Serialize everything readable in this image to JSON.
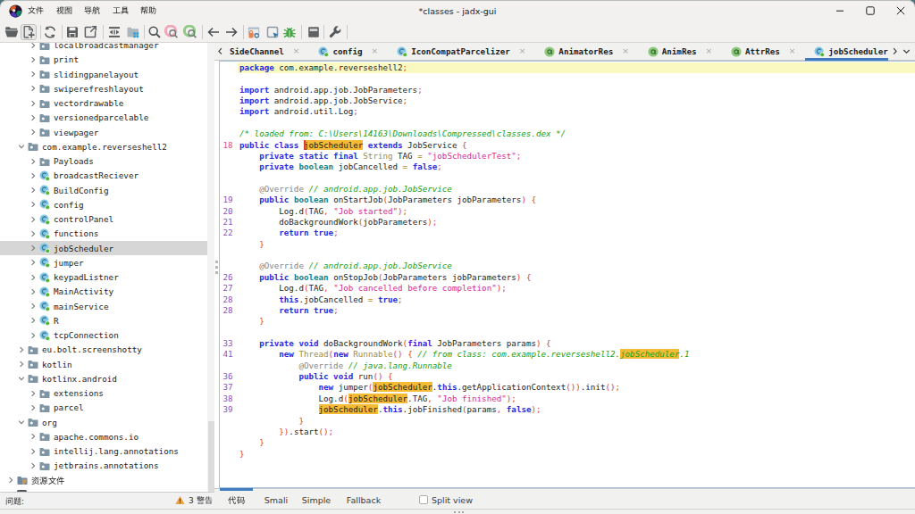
{
  "window": {
    "title": "*classes - jadx-gui",
    "menus": [
      "文件",
      "视图",
      "导航",
      "工具",
      "帮助"
    ],
    "controls": {
      "minimize": "minimize",
      "maximize": "maximize",
      "close": "close"
    }
  },
  "toolbar": {
    "items": [
      "open-file",
      "add-files",
      "reload",
      "save-all",
      "export",
      "deobfuscation",
      "flat-packages",
      "text-search",
      "class-search",
      "comment-search",
      "back",
      "forward",
      "open-main-activity",
      "select-in-tree",
      "debugger",
      "log-viewer",
      "preferences"
    ]
  },
  "tree": {
    "items": [
      {
        "label": "localbroadcastmanager",
        "icon": "package",
        "level": 2,
        "exp": false,
        "sel": false
      },
      {
        "label": "print",
        "icon": "package",
        "level": 2,
        "exp": false,
        "sel": false
      },
      {
        "label": "slidingpanelayout",
        "icon": "package",
        "level": 2,
        "exp": false,
        "sel": false
      },
      {
        "label": "swiperefreshlayout",
        "icon": "package",
        "level": 2,
        "exp": false,
        "sel": false
      },
      {
        "label": "vectordrawable",
        "icon": "package",
        "level": 2,
        "exp": false,
        "sel": false
      },
      {
        "label": "versionedparcelable",
        "icon": "package",
        "level": 2,
        "exp": false,
        "sel": false
      },
      {
        "label": "viewpager",
        "icon": "package",
        "level": 2,
        "exp": false,
        "sel": false
      },
      {
        "label": "com.example.reverseshell2",
        "icon": "package",
        "level": 1,
        "exp": true,
        "sel": false
      },
      {
        "label": "Payloads",
        "icon": "package",
        "level": 2,
        "exp": false,
        "sel": false
      },
      {
        "label": "broadcastReciever",
        "icon": "class",
        "level": 2,
        "exp": false,
        "sel": false
      },
      {
        "label": "BuildConfig",
        "icon": "class",
        "level": 2,
        "exp": false,
        "sel": false
      },
      {
        "label": "config",
        "icon": "class",
        "level": 2,
        "exp": false,
        "sel": false
      },
      {
        "label": "controlPanel",
        "icon": "class",
        "level": 2,
        "exp": false,
        "sel": false
      },
      {
        "label": "functions",
        "icon": "class",
        "level": 2,
        "exp": false,
        "sel": false
      },
      {
        "label": "jobScheduler",
        "icon": "class",
        "level": 2,
        "exp": false,
        "sel": true
      },
      {
        "label": "jumper",
        "icon": "class",
        "level": 2,
        "exp": false,
        "sel": false
      },
      {
        "label": "keypadListner",
        "icon": "class",
        "level": 2,
        "exp": false,
        "sel": false
      },
      {
        "label": "MainActivity",
        "icon": "class",
        "level": 2,
        "exp": false,
        "sel": false
      },
      {
        "label": "mainService",
        "icon": "class",
        "level": 2,
        "exp": false,
        "sel": false
      },
      {
        "label": "R",
        "icon": "class",
        "level": 2,
        "exp": false,
        "sel": false
      },
      {
        "label": "tcpConnection",
        "icon": "class",
        "level": 2,
        "exp": false,
        "sel": false
      },
      {
        "label": "eu.bolt.screenshotty",
        "icon": "package",
        "level": 1,
        "exp": false,
        "sel": false
      },
      {
        "label": "kotlin",
        "icon": "package",
        "level": 1,
        "exp": false,
        "sel": false
      },
      {
        "label": "kotlinx.android",
        "icon": "package",
        "level": 1,
        "exp": true,
        "sel": false
      },
      {
        "label": "extensions",
        "icon": "package",
        "level": 2,
        "exp": false,
        "sel": false
      },
      {
        "label": "parcel",
        "icon": "package",
        "level": 2,
        "exp": false,
        "sel": false
      },
      {
        "label": "org",
        "icon": "package",
        "level": 1,
        "exp": true,
        "sel": false
      },
      {
        "label": "apache.commons.io",
        "icon": "package",
        "level": 2,
        "exp": false,
        "sel": false
      },
      {
        "label": "intellij.lang.annotations",
        "icon": "package",
        "level": 2,
        "exp": false,
        "sel": false
      },
      {
        "label": "jetbrains.annotations",
        "icon": "package",
        "level": 2,
        "exp": false,
        "sel": false
      },
      {
        "label": "资源文件",
        "icon": "resdir",
        "level": 0,
        "exp": false,
        "sel": false,
        "cjk": true
      },
      {
        "label": "",
        "icon": "cut",
        "level": 0,
        "exp": false,
        "sel": false
      }
    ]
  },
  "problems": {
    "label": "问题:",
    "warn_count": "3",
    "warn_label": "警告"
  },
  "editor_tabs": [
    {
      "label": "SideChannel",
      "icon": "none",
      "active": false,
      "close": true
    },
    {
      "label": "config",
      "icon": "class",
      "active": false,
      "close": true
    },
    {
      "label": "IconCompatParcelizer",
      "icon": "class",
      "active": false,
      "close": true
    },
    {
      "label": "AnimatorRes",
      "icon": "annotation",
      "active": false,
      "close": true
    },
    {
      "label": "AnimRes",
      "icon": "annotation",
      "active": false,
      "close": true
    },
    {
      "label": "AttrRes",
      "icon": "annotation",
      "active": false,
      "close": true
    },
    {
      "label": "jobScheduler",
      "icon": "class",
      "active": true,
      "close": false
    }
  ],
  "code": {
    "lines": [
      {
        "n": "",
        "cur": true,
        "segs": [
          [
            "k",
            "package"
          ],
          [
            "i",
            " com.example.reverseshell2"
          ],
          [
            "p",
            ";"
          ]
        ]
      },
      {
        "n": "",
        "segs": []
      },
      {
        "n": "",
        "segs": [
          [
            "k",
            "import"
          ],
          [
            "i",
            " android.app.job.JobParameters"
          ],
          [
            "p",
            ";"
          ]
        ]
      },
      {
        "n": "",
        "segs": [
          [
            "k",
            "import"
          ],
          [
            "i",
            " android.app.job.JobService"
          ],
          [
            "p",
            ";"
          ]
        ]
      },
      {
        "n": "",
        "segs": [
          [
            "k",
            "import"
          ],
          [
            "i",
            " android.util.Log"
          ],
          [
            "p",
            ";"
          ]
        ]
      },
      {
        "n": "",
        "segs": []
      },
      {
        "n": "",
        "segs": [
          [
            "c",
            "/* loaded from: C:\\Users\\14163\\Downloads\\Compressed\\classes.dex */"
          ]
        ]
      },
      {
        "n": "18",
        "npink": true,
        "segs": [
          [
            "k",
            "public class "
          ],
          [
            "caret",
            ""
          ],
          [
            "hi",
            "jobScheduler"
          ],
          [
            "k",
            " extends"
          ],
          [
            "i",
            " JobService "
          ],
          [
            "p",
            "{"
          ]
        ]
      },
      {
        "n": "",
        "segs": [
          [
            "i",
            "    "
          ],
          [
            "k",
            "private static final"
          ],
          [
            "f",
            " String"
          ],
          [
            "i",
            " TAG "
          ],
          [
            "o",
            "="
          ],
          [
            "s",
            " \"jobSchedulerTest\""
          ],
          [
            "p",
            ";"
          ]
        ]
      },
      {
        "n": "",
        "segs": [
          [
            "i",
            "    "
          ],
          [
            "k",
            "private"
          ],
          [
            "t",
            " boolean"
          ],
          [
            "i",
            " jobCancelled "
          ],
          [
            "o",
            "="
          ],
          [
            "k",
            " false"
          ],
          [
            "p",
            ";"
          ]
        ]
      },
      {
        "n": "",
        "segs": []
      },
      {
        "n": "",
        "segs": [
          [
            "i",
            "    "
          ],
          [
            "a",
            "@Override "
          ],
          [
            "c",
            "// android.app.job.JobService"
          ]
        ]
      },
      {
        "n": "19",
        "segs": [
          [
            "i",
            "    "
          ],
          [
            "k",
            "public"
          ],
          [
            "t",
            " boolean"
          ],
          [
            "i",
            " onStartJob"
          ],
          [
            "p",
            "("
          ],
          [
            "i",
            "JobParameters jobParameters"
          ],
          [
            "p",
            ") {"
          ]
        ]
      },
      {
        "n": "20",
        "segs": [
          [
            "i",
            "        Log.d"
          ],
          [
            "p",
            "("
          ],
          [
            "i",
            "TAG"
          ],
          [
            "p",
            ","
          ],
          [
            "s",
            " \"Job started\""
          ],
          [
            "p",
            ");"
          ]
        ]
      },
      {
        "n": "21",
        "segs": [
          [
            "i",
            "        doBackgroundWork"
          ],
          [
            "p",
            "("
          ],
          [
            "i",
            "jobParameters"
          ],
          [
            "p",
            ");"
          ]
        ]
      },
      {
        "n": "22",
        "segs": [
          [
            "i",
            "        "
          ],
          [
            "k",
            "return true"
          ],
          [
            "p",
            ";"
          ]
        ]
      },
      {
        "n": "",
        "segs": [
          [
            "i",
            "    "
          ],
          [
            "p",
            "}"
          ]
        ]
      },
      {
        "n": "",
        "segs": []
      },
      {
        "n": "",
        "segs": [
          [
            "i",
            "    "
          ],
          [
            "a",
            "@Override "
          ],
          [
            "c",
            "// android.app.job.JobService"
          ]
        ]
      },
      {
        "n": "26",
        "segs": [
          [
            "i",
            "    "
          ],
          [
            "k",
            "public"
          ],
          [
            "t",
            " boolean"
          ],
          [
            "i",
            " onStopJob"
          ],
          [
            "p",
            "("
          ],
          [
            "i",
            "JobParameters jobParameters"
          ],
          [
            "p",
            ") {"
          ]
        ]
      },
      {
        "n": "27",
        "segs": [
          [
            "i",
            "        Log.d"
          ],
          [
            "p",
            "("
          ],
          [
            "i",
            "TAG"
          ],
          [
            "p",
            ","
          ],
          [
            "s",
            " \"Job cancelled before completion\""
          ],
          [
            "p",
            ");"
          ]
        ]
      },
      {
        "n": "28",
        "segs": [
          [
            "i",
            "        "
          ],
          [
            "k",
            "this"
          ],
          [
            "i",
            ".jobCancelled "
          ],
          [
            "o",
            "="
          ],
          [
            "k",
            " true"
          ],
          [
            "p",
            ";"
          ]
        ]
      },
      {
        "n": "28",
        "segs": [
          [
            "i",
            "        "
          ],
          [
            "k",
            "return true"
          ],
          [
            "p",
            ";"
          ]
        ]
      },
      {
        "n": "",
        "segs": [
          [
            "i",
            "    "
          ],
          [
            "p",
            "}"
          ]
        ]
      },
      {
        "n": "",
        "segs": []
      },
      {
        "n": "33",
        "segs": [
          [
            "i",
            "    "
          ],
          [
            "k",
            "private void"
          ],
          [
            "i",
            " doBackgroundWork"
          ],
          [
            "p",
            "("
          ],
          [
            "k",
            "final"
          ],
          [
            "i",
            " JobParameters params"
          ],
          [
            "p",
            ") {"
          ]
        ]
      },
      {
        "n": "41",
        "segs": [
          [
            "i",
            "        "
          ],
          [
            "k",
            "new"
          ],
          [
            "f",
            " Thread"
          ],
          [
            "p",
            "("
          ],
          [
            "k",
            "new"
          ],
          [
            "f",
            " Runnable"
          ],
          [
            "p",
            "() {"
          ],
          [
            "c",
            " // from class: com.example.reverseshell2."
          ],
          [
            "hic",
            "jobScheduler"
          ],
          [
            "c",
            ".1"
          ]
        ]
      },
      {
        "n": "",
        "segs": [
          [
            "i",
            "            "
          ],
          [
            "a",
            "@Override "
          ],
          [
            "c",
            "// java.lang.Runnable"
          ]
        ]
      },
      {
        "n": "36",
        "segs": [
          [
            "i",
            "            "
          ],
          [
            "k",
            "public void"
          ],
          [
            "i",
            " run"
          ],
          [
            "p",
            "()"
          ],
          [
            "i",
            " "
          ],
          [
            "p",
            "{"
          ]
        ]
      },
      {
        "n": "37",
        "segs": [
          [
            "i",
            "                "
          ],
          [
            "k",
            "new"
          ],
          [
            "i",
            " jumper"
          ],
          [
            "p",
            "("
          ],
          [
            "hi",
            "jobScheduler"
          ],
          [
            "i",
            "."
          ],
          [
            "k",
            "this"
          ],
          [
            "i",
            ".getApplicationContext"
          ],
          [
            "p",
            "())"
          ],
          [
            "i",
            ".init"
          ],
          [
            "p",
            "();"
          ]
        ]
      },
      {
        "n": "38",
        "segs": [
          [
            "i",
            "                Log.d"
          ],
          [
            "p",
            "("
          ],
          [
            "hi",
            "jobScheduler"
          ],
          [
            "i",
            ".TAG"
          ],
          [
            "p",
            ","
          ],
          [
            "s",
            " \"Job finished\""
          ],
          [
            "p",
            ");"
          ]
        ]
      },
      {
        "n": "39",
        "segs": [
          [
            "i",
            "                "
          ],
          [
            "hi",
            "jobScheduler"
          ],
          [
            "i",
            "."
          ],
          [
            "k",
            "this"
          ],
          [
            "i",
            ".jobFinished"
          ],
          [
            "p",
            "("
          ],
          [
            "i",
            "params"
          ],
          [
            "p",
            ","
          ],
          [
            "k",
            " false"
          ],
          [
            "p",
            ");"
          ]
        ]
      },
      {
        "n": "",
        "segs": [
          [
            "i",
            "            "
          ],
          [
            "p",
            "}"
          ]
        ]
      },
      {
        "n": "",
        "segs": [
          [
            "i",
            "        "
          ],
          [
            "p",
            "})"
          ],
          [
            "i",
            ".start"
          ],
          [
            "p",
            "();"
          ]
        ]
      },
      {
        "n": "",
        "segs": [
          [
            "i",
            "    "
          ],
          [
            "p",
            "}"
          ]
        ]
      },
      {
        "n": "",
        "segs": [
          [
            "p",
            "}"
          ]
        ]
      }
    ]
  },
  "bottom_tabs": {
    "items": [
      {
        "label": "代码",
        "cjk": true,
        "active": true
      },
      {
        "label": "Smali",
        "cjk": false,
        "active": false
      },
      {
        "label": "Simple",
        "cjk": false,
        "active": false
      },
      {
        "label": "Fallback",
        "cjk": false,
        "active": false
      }
    ],
    "split_view": "Split view"
  },
  "colors": {
    "accent_blue": "#3E7BBF",
    "selection_gray": "#D6D6D6",
    "current_line": "#FBF9C2",
    "occurrence": "#F5BB35",
    "warning_orange": "#E9A440"
  }
}
